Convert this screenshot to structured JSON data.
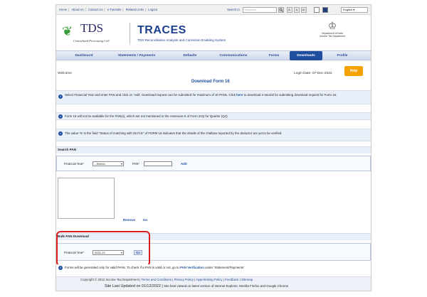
{
  "topbar": {
    "links": [
      "Home",
      "About Us",
      "Contact Us",
      "e-Tutorials",
      "Related Links",
      "Logout"
    ],
    "search_label": "Search in",
    "search_placeholder": "Keyword",
    "font_buttons": [
      "A-",
      "A",
      "A+"
    ],
    "language": "English"
  },
  "header": {
    "logo_text": "TDS",
    "logo_caption": "Centralized Processing Cell",
    "app_title": "TRACES",
    "app_subtitle": "TDS Reconciliation Analysis and Correction Enabling System",
    "emblem_caption_1": "Department of India",
    "emblem_caption_2": "Income Tax Department"
  },
  "nav": {
    "items": [
      "Dashboard",
      "Statements / Payments",
      "Defaults",
      "Communications",
      "Forms",
      "Downloads",
      "Profile"
    ],
    "active": "Downloads"
  },
  "main": {
    "welcome": "Welcome",
    "title": "Download Form 16",
    "login_date": "Login Date: 07-Dec-2022",
    "help": "Help",
    "info1_pre": "Select Financial Year and enter PAN and click on 'Add'. Download request can be submitted for maximum of 10 PANs. Click ",
    "info1_link": "here",
    "info1_post": " to download e-tutorial for submitting download request for Form 16.",
    "info2": "Form 16 will not be available for the PAN(s), which are not mentioned in the Annexure-II of Form 24Q for Quarter (Q4)",
    "info3": "The value 'N' in the field \"Status of matching with OLTAS\" of FORM 16 indicates that the details of the challans reported by the deductor are yet to be verified.",
    "search_pan": {
      "title": "Search PAN",
      "fy_label": "Financial Year*",
      "fy_value": "--Select--",
      "pan_label": "PAN*",
      "pan_value": "",
      "add": "Add"
    },
    "remove": "Remove",
    "go_upper": "Go",
    "bulk": {
      "title": "Bulk PAN Download",
      "fy_label": "Financial Year*",
      "fy_value": "2021-22",
      "go": "Go"
    },
    "note_pre": "Forms will be generated only for valid PANs. To check if a PAN is valid or not, go to ",
    "note_link": "PAN Verification",
    "note_post": " under 'Statement/Payments'"
  },
  "footer": {
    "copyright": "Copyright © 2012 Income Tax Department",
    "links": [
      "Terms and Conditions",
      "Privacy Policy",
      "Hyperlinking Policy",
      "Feedback",
      "Sitemap"
    ],
    "updated": "Site Last Updated on 01/12/2022",
    "best_viewed": "Site best viewed on latest version of Internet Explorer, Mozilla Firefox and Google Chrome"
  },
  "colors": {
    "brand": "#1f4f9e",
    "help": "#f5a100",
    "highlight": "#d81e1e"
  }
}
